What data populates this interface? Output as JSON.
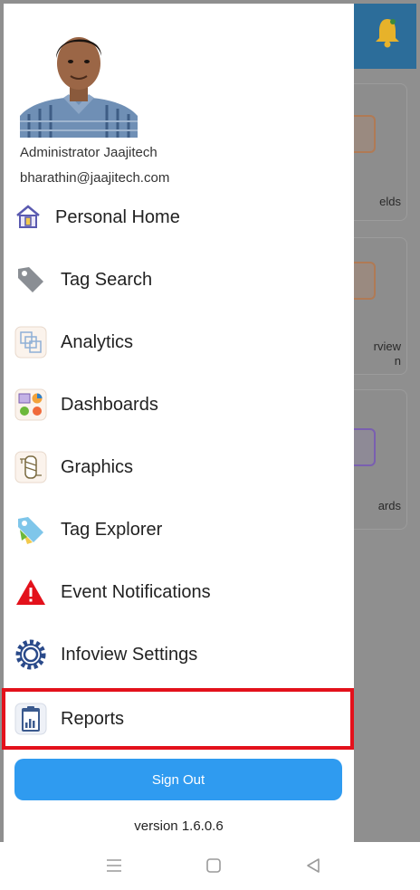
{
  "user": {
    "name": "Administrator Jaajitech",
    "email": "bharathin@jaajitech.com"
  },
  "menu": {
    "items": [
      {
        "label": "Personal Home",
        "icon": "house-icon"
      },
      {
        "label": "Tag Search",
        "icon": "tag-icon"
      },
      {
        "label": "Analytics",
        "icon": "analytics-icon"
      },
      {
        "label": "Dashboards",
        "icon": "dashboard-icon"
      },
      {
        "label": "Graphics",
        "icon": "graphics-icon"
      },
      {
        "label": "Tag Explorer",
        "icon": "tag-explorer-icon"
      },
      {
        "label": "Event Notifications",
        "icon": "warning-icon"
      },
      {
        "label": "Infoview Settings",
        "icon": "gear-icon"
      },
      {
        "label": "Reports",
        "icon": "clipboard-report-icon"
      }
    ],
    "highlighted": "Reports"
  },
  "sign_out_label": "Sign Out",
  "version_text": "version 1.6.0.6",
  "background": {
    "card_labels": [
      "elds",
      "rview",
      "n",
      "ards"
    ]
  },
  "colors": {
    "accent": "#2f9bf0",
    "highlight_border": "#e3111b",
    "header": "#2c6d9a"
  }
}
